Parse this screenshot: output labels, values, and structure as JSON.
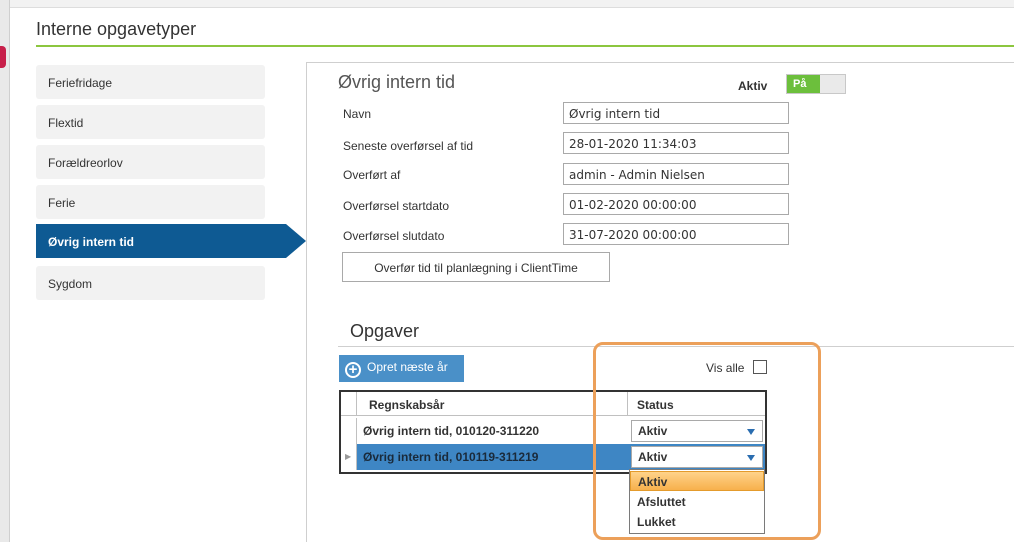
{
  "app": {
    "section_title": "Interne opgavetyper"
  },
  "sidebar": {
    "items": [
      {
        "label": "Feriefridage",
        "active": false
      },
      {
        "label": "Flextid",
        "active": false
      },
      {
        "label": "Forældreorlov",
        "active": false
      },
      {
        "label": "Ferie",
        "active": false
      },
      {
        "label": "Øvrig intern tid",
        "active": true
      },
      {
        "label": "Sygdom",
        "active": false
      }
    ]
  },
  "detail": {
    "title": "Øvrig intern tid",
    "active_label": "Aktiv",
    "toggle_on_label": "På",
    "fields": [
      {
        "label": "Navn",
        "value": "Øvrig intern tid"
      },
      {
        "label": "Seneste overførsel af tid",
        "value": "28-01-2020 11:34:03"
      },
      {
        "label": "Overført af",
        "value": "admin - Admin Nielsen"
      },
      {
        "label": "Overførsel startdato",
        "value": "01-02-2020 00:00:00"
      },
      {
        "label": "Overførsel slutdato",
        "value": "31-07-2020 00:00:00"
      }
    ],
    "transfer_button": "Overfør tid til planlægning i ClientTime"
  },
  "tasks": {
    "title": "Opgaver",
    "create_button": "Opret næste år",
    "show_all_label": "Vis alle",
    "columns": [
      "Regnskabsår",
      "Status"
    ],
    "rows": [
      {
        "name": "Øvrig intern tid, 010120-311220",
        "status": "Aktiv",
        "selected": false
      },
      {
        "name": "Øvrig intern tid, 010119-311219",
        "status": "Aktiv",
        "selected": true
      }
    ],
    "status_options": [
      "Aktiv",
      "Afsluttet",
      "Lukket"
    ],
    "highlighted_option": "Aktiv"
  },
  "colors": {
    "accent_green": "#8cc63f",
    "nav_active": "#0e5a93",
    "toggle_on": "#6cbf3c",
    "row_selected": "#3e86c4",
    "annotation_orange": "#eca05a"
  }
}
